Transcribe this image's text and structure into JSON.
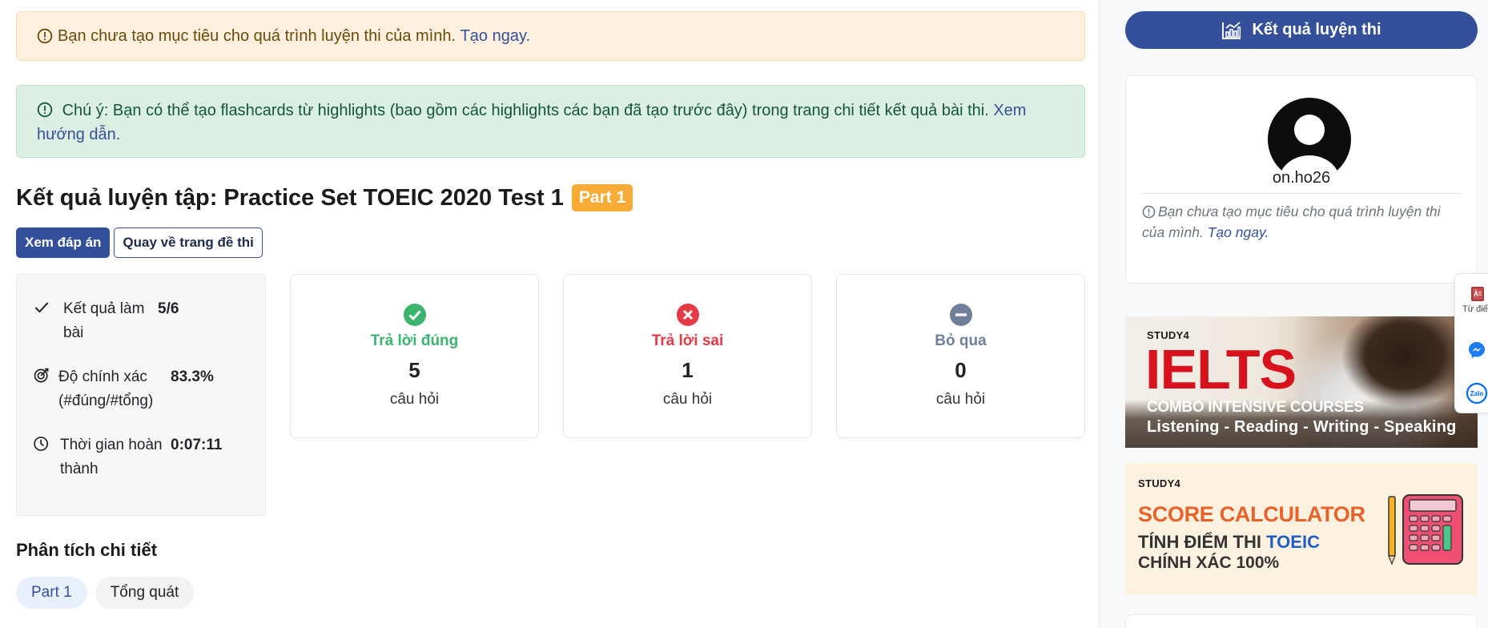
{
  "main": {
    "goal_alert": {
      "text": "Bạn chưa tạo mục tiêu cho quá trình luyện thi của mình.",
      "link": "Tạo ngay."
    },
    "note_alert": {
      "text": "Chú ý: Bạn có thể tạo flashcards từ highlights (bao gồm các highlights các bạn đã tạo trước đây) trong trang chi tiết kết quả bài thi.",
      "link": "Xem hướng dẫn."
    },
    "title": "Kết quả luyện tập: Practice Set TOEIC 2020 Test 1",
    "part_badge": "Part 1",
    "buttons": {
      "view_answers": "Xem đáp án",
      "back_to_test": "Quay về trang đề thi"
    },
    "summary": [
      {
        "label": "Kết quả làm bài",
        "value": "5/6",
        "icon": "check-icon"
      },
      {
        "label": "Độ chính xác (#đúng/#tổng)",
        "value": "83.3%",
        "icon": "target-icon"
      },
      {
        "label": "Thời gian hoàn thành",
        "value": "0:07:11",
        "icon": "clock-icon"
      }
    ],
    "cards": [
      {
        "label": "Trả lời đúng",
        "value": "5",
        "unit": "câu hỏi",
        "icon": "check-circle-icon",
        "color": "#3cb46e"
      },
      {
        "label": "Trả lời sai",
        "value": "1",
        "unit": "câu hỏi",
        "icon": "x-circle-icon",
        "color": "#e43a45"
      },
      {
        "label": "Bỏ qua",
        "value": "0",
        "unit": "câu hỏi",
        "icon": "minus-circle-icon",
        "color": "#71809a"
      }
    ],
    "analysis_title": "Phân tích chi tiết",
    "tabs": [
      {
        "label": "Part 1",
        "active": true
      },
      {
        "label": "Tổng quát",
        "active": false
      }
    ]
  },
  "sidebar": {
    "results_button": "Kết quả luyện thi",
    "profile": {
      "username": "on.ho26",
      "note": "Bạn chưa tạo mục tiêu cho quá trình luyện thi của mình.",
      "note_link": "Tạo ngay."
    },
    "ielts_banner": {
      "brand": "STUDY4",
      "headline": "IELTS",
      "subtitle": "COMBO INTENSIVE COURSES",
      "skills": "Listening - Reading - Writing - Speaking"
    },
    "score_banner": {
      "brand": "STUDY4",
      "title": "SCORE CALCULATOR",
      "line2_prefix": "TÍNH ĐIỂM THI",
      "line2_highlight": "TOEIC",
      "line3": "CHÍNH XÁC 100%"
    },
    "floating": {
      "dictionary_label": "Từ điển"
    }
  },
  "colors": {
    "primary": "#35509a",
    "badge": "#f9ab37",
    "correct": "#3cb46e",
    "wrong": "#e43a45",
    "skip": "#71809a"
  }
}
